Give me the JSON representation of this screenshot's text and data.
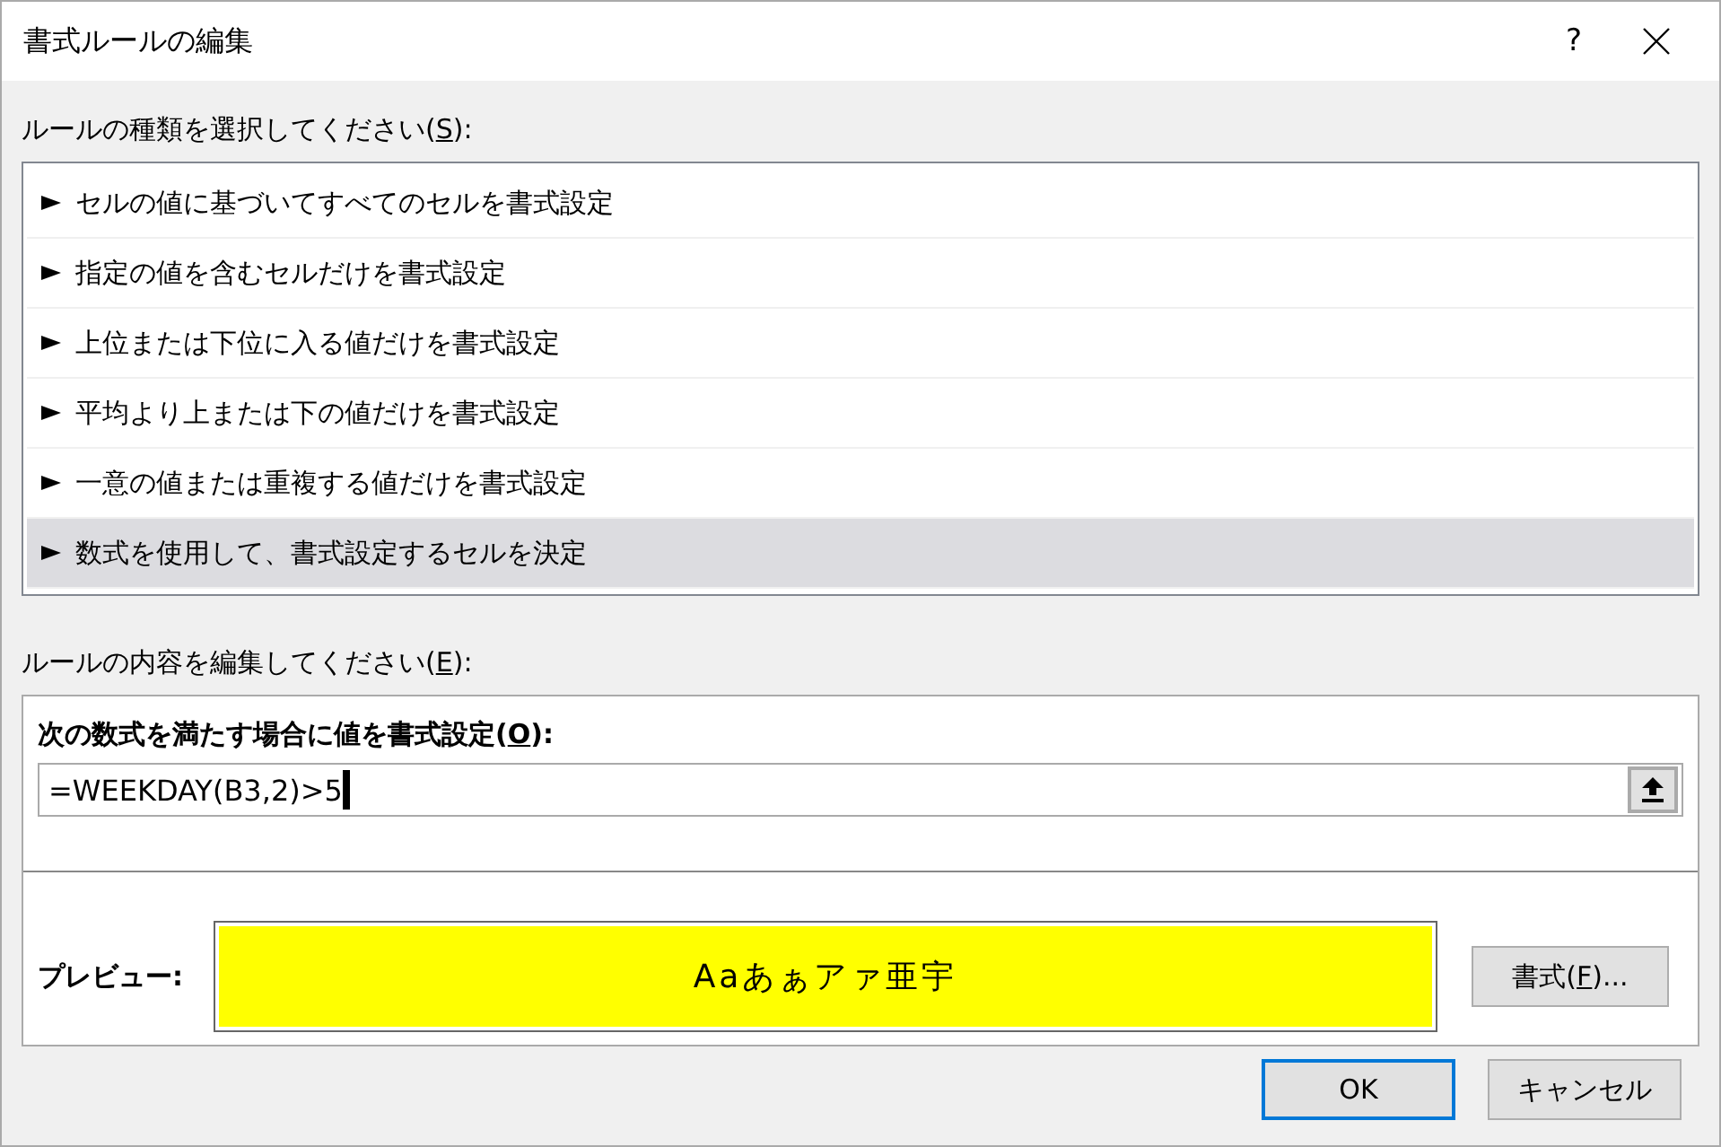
{
  "window": {
    "title": "書式ルールの編集",
    "help": "?"
  },
  "rule_type_label": {
    "before": "ルールの種類を選択してください(",
    "key": "S",
    "after": "):"
  },
  "rule_types": [
    {
      "label": "セルの値に基づいてすべてのセルを書式設定",
      "selected": false
    },
    {
      "label": "指定の値を含むセルだけを書式設定",
      "selected": false
    },
    {
      "label": "上位または下位に入る値だけを書式設定",
      "selected": false
    },
    {
      "label": "平均より上または下の値だけを書式設定",
      "selected": false
    },
    {
      "label": "一意の値または重複する値だけを書式設定",
      "selected": false
    },
    {
      "label": "数式を使用して、書式設定するセルを決定",
      "selected": true
    }
  ],
  "rule_edit_label": {
    "before": "ルールの内容を編集してください(",
    "key": "E",
    "after": "):"
  },
  "formula_label": {
    "before": "次の数式を満たす場合に値を書式設定(",
    "key": "O",
    "after": "):"
  },
  "formula": {
    "value": "=WEEKDAY(B3,2)>5"
  },
  "preview": {
    "label": "プレビュー:",
    "sample": "Aaあぁアァ亜宇"
  },
  "format_button": {
    "before": "書式(",
    "key": "F",
    "after": ")..."
  },
  "buttons": [
    {
      "label": "OK",
      "default": true
    },
    {
      "label": "キャンセル",
      "default": false
    }
  ]
}
